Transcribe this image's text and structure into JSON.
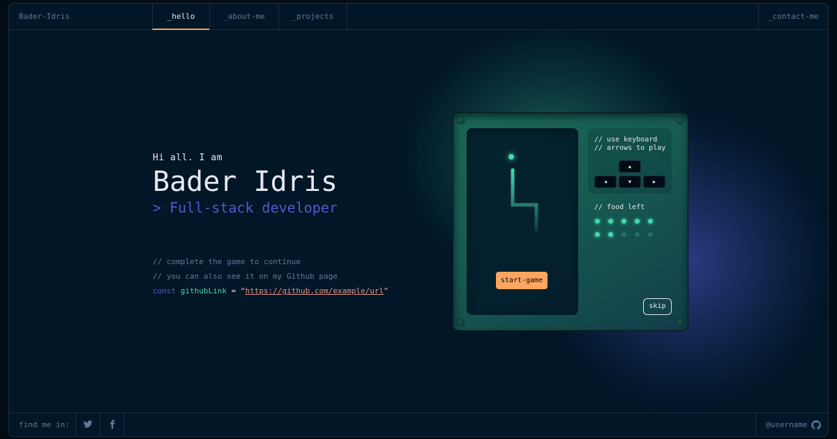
{
  "header": {
    "brand": "Bader-Idris",
    "tabs": [
      {
        "label": "_hello",
        "active": true
      },
      {
        "label": "_about-me",
        "active": false
      },
      {
        "label": "_projects",
        "active": false
      }
    ],
    "contact": "_contact-me"
  },
  "hero": {
    "greeting": "Hi all. I am",
    "name": "Bader Idris",
    "role": "> Full-stack developer"
  },
  "code": {
    "comment1": "// complete the game to continue",
    "comment2": "// you can also see it on my Github page",
    "keyword": "const",
    "variable": "githubLink",
    "operator": " = ",
    "open_quote": "“",
    "url": "https://github.com/example/url",
    "close_quote": "”"
  },
  "game": {
    "start_label": "start-game",
    "instructions": "// use keyboard\n// arrows to play",
    "keys": {
      "up": "▲",
      "left": "◀",
      "down": "▼",
      "right": "▶"
    },
    "food_label": "// food left",
    "food_total": 10,
    "food_remaining": 7,
    "skip_label": "skip"
  },
  "footer": {
    "find_me": "find me in:",
    "socials": [
      {
        "name": "twitter",
        "icon": "twitter-icon"
      },
      {
        "name": "facebook",
        "icon": "facebook-icon"
      }
    ],
    "username": "@username",
    "github_icon": "github-icon"
  },
  "colors": {
    "accent_orange": "#fea55f",
    "accent_green": "#43d9ad",
    "accent_blue": "#4d5bce",
    "text_primary": "#e5e9f0",
    "text_muted": "#607b96",
    "string": "#e99287",
    "background": "#011627"
  }
}
